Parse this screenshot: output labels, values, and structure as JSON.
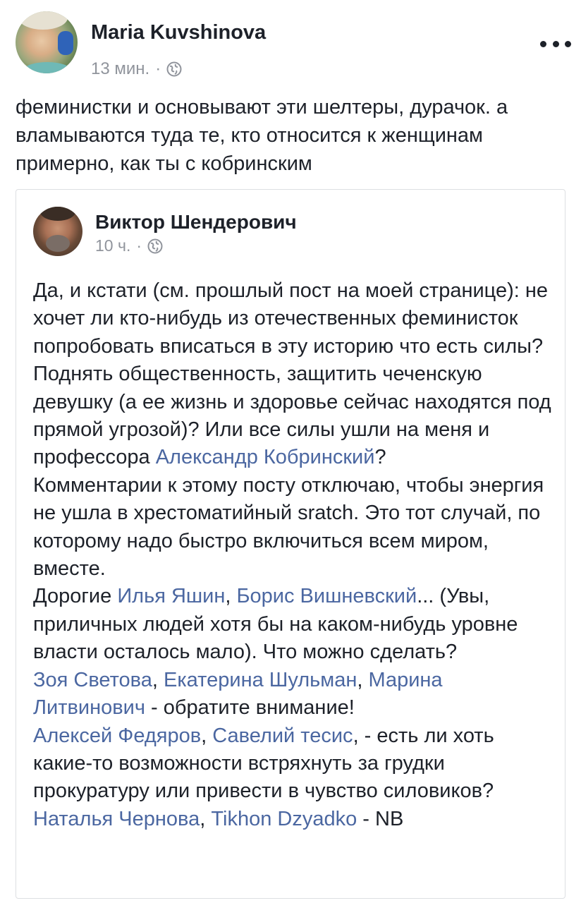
{
  "post": {
    "author": "Maria Kuvshinova",
    "time": "13 мин.",
    "separator": "·",
    "privacy_icon": "globe-icon",
    "more_icon": "more-options-icon",
    "text": "феминистки и основывают эти шелтеры, дурачок. а вламываются туда те, кто относится к женщинам примерно, как ты с кобринским"
  },
  "shared_post": {
    "author": "Виктор Шендерович",
    "time": "10 ч.",
    "separator": "·",
    "privacy_icon": "globe-icon",
    "segments": [
      {
        "text": "Да, и кстати (см. прошлый пост на моей странице): не хочет ли кто-нибудь из отечественных феминисток попробовать вписаться в эту историю что есть силы? Поднять общественность, защитить чеченскую девушку (а ее жизнь и здоровье сейчас находятся под прямой угрозой)? Или все силы ушли на меня и профессора "
      },
      {
        "text": "Александр Кобринский",
        "link": true
      },
      {
        "text": "?\nКомментарии к этому посту отключаю, чтобы энергия не ушла в хрестоматийный sratch. Это тот случай, по которому надо быстро включиться всем миром, вместе.\nДорогие "
      },
      {
        "text": "Илья Яшин",
        "link": true
      },
      {
        "text": ", "
      },
      {
        "text": "Борис Вишневский",
        "link": true
      },
      {
        "text": "... (Увы, приличных людей хотя бы на каком-нибудь уровне власти осталось мало). Что можно сделать?\n"
      },
      {
        "text": "Зоя Светова",
        "link": true
      },
      {
        "text": ", "
      },
      {
        "text": "Екатерина Шульман",
        "link": true
      },
      {
        "text": ", "
      },
      {
        "text": "Марина Литвинович",
        "link": true
      },
      {
        "text": " - обратите внимание!\n"
      },
      {
        "text": "Алексей Федяров",
        "link": true
      },
      {
        "text": ", "
      },
      {
        "text": "Савелий тесис",
        "link": true
      },
      {
        "text": ", - есть ли хоть какие-то возможности встряхнуть за грудки прокуратуру или привести в чувство силовиков?\n"
      },
      {
        "text": "Наталья Чернова",
        "link": true
      },
      {
        "text": ", "
      },
      {
        "text": "Tikhon Dzyadko",
        "link": true
      },
      {
        "text": " - NB"
      }
    ]
  },
  "colors": {
    "text": "#1d2129",
    "meta": "#90949c",
    "link": "#4b67a1",
    "border": "#dddfe2"
  }
}
